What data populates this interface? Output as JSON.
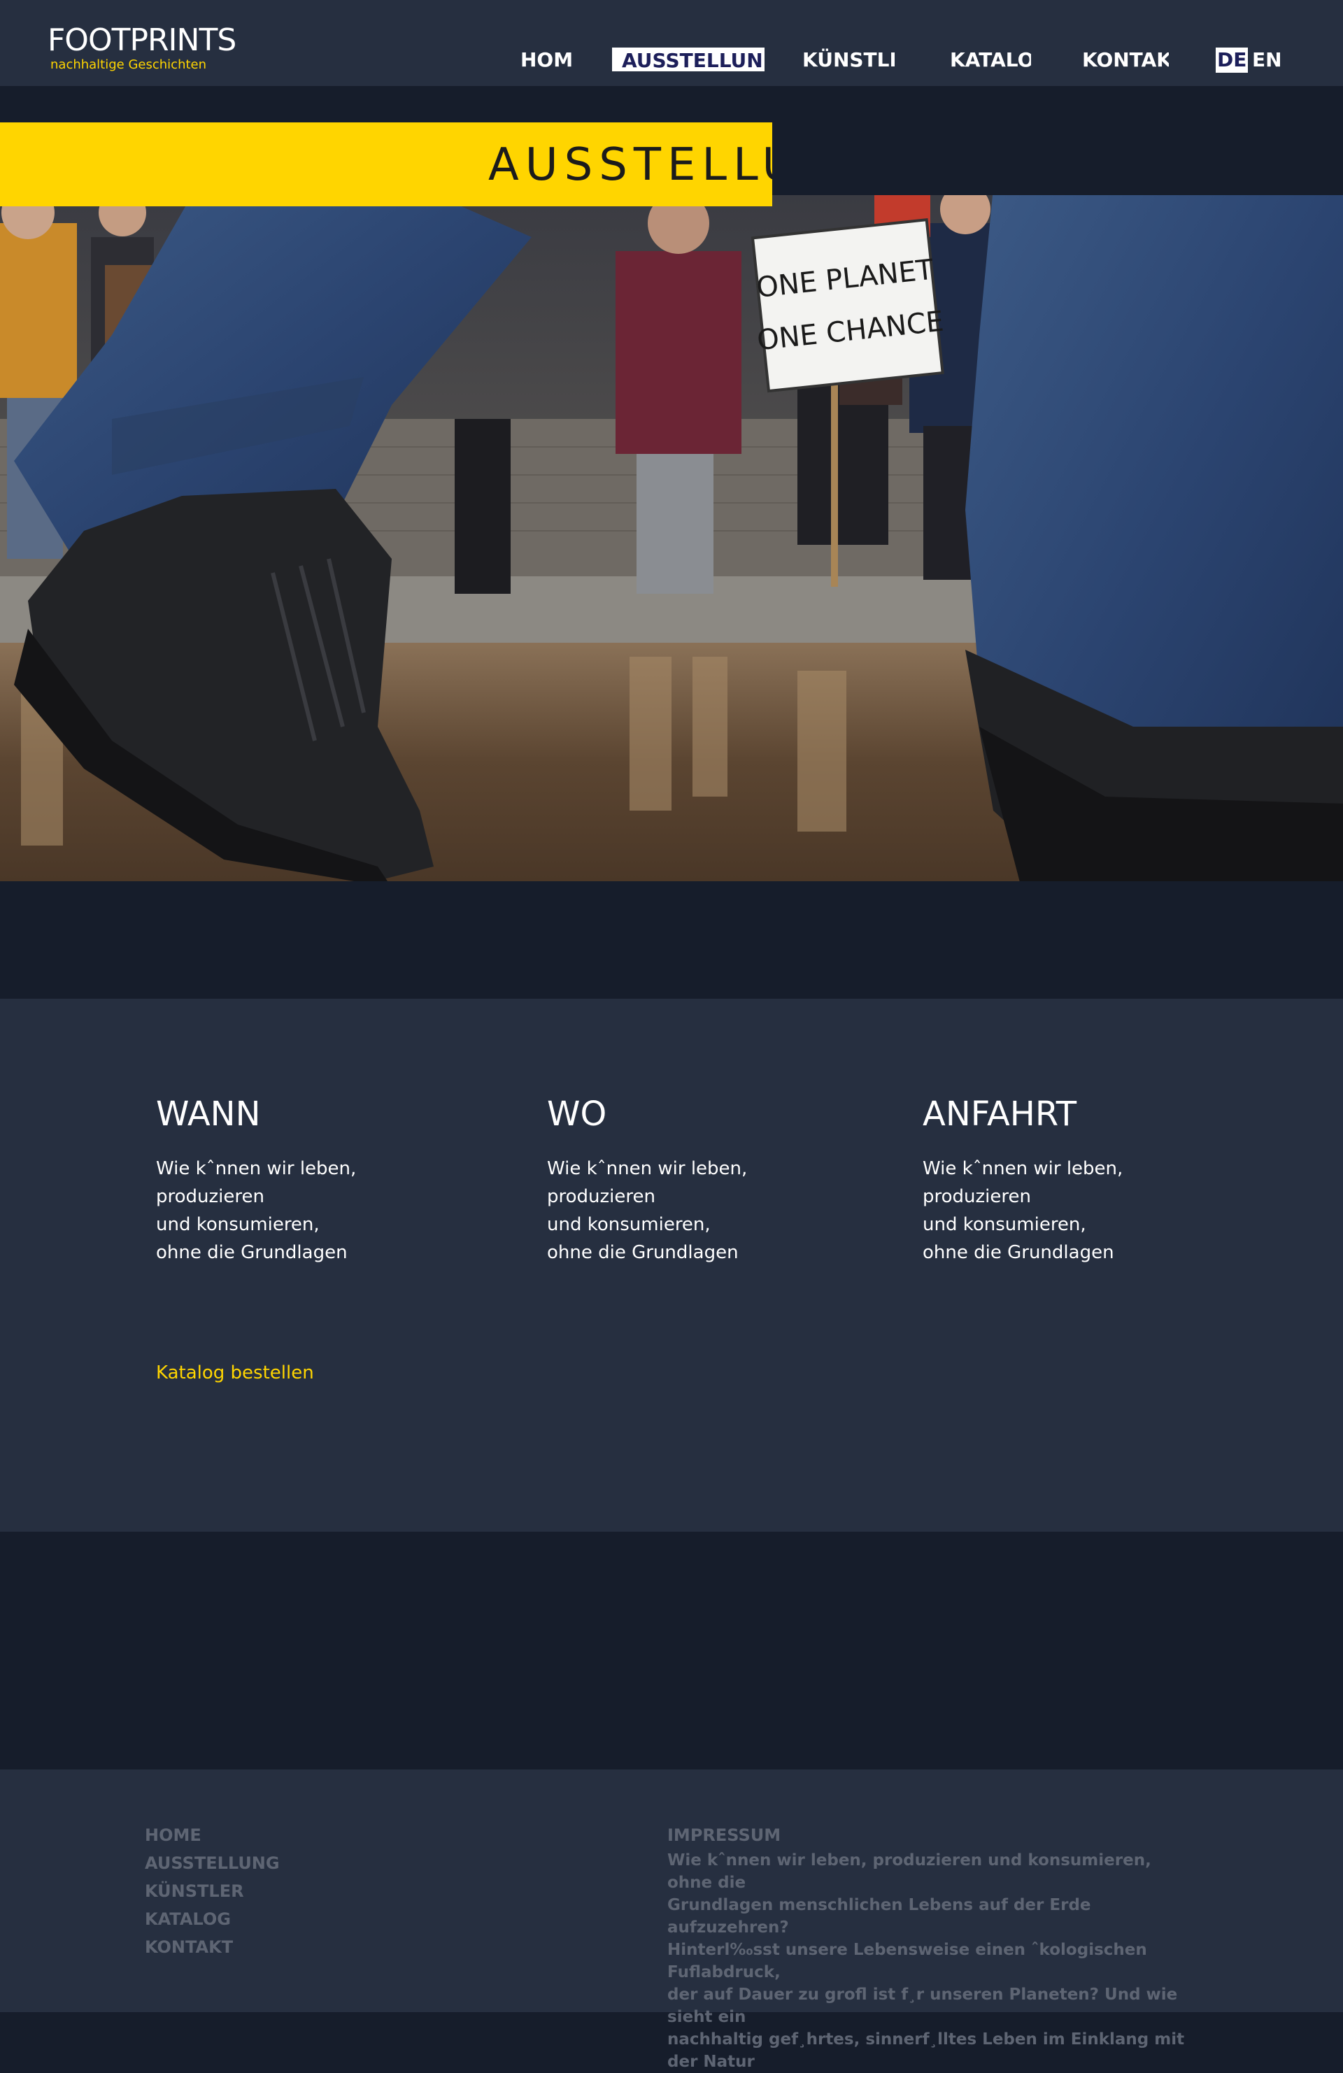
{
  "brand": {
    "name": "FOOTPRINTS",
    "tagline": "nachhaltige Geschichten"
  },
  "nav": {
    "items": [
      {
        "label": "HOM",
        "active": false
      },
      {
        "label": "AUSSTELLUN",
        "active": true
      },
      {
        "label": "KÜNSTLE",
        "active": false
      },
      {
        "label": "KATALO",
        "active": false
      },
      {
        "label": "KONTAK",
        "active": false
      }
    ],
    "languages": [
      {
        "label": "DE",
        "active": true
      },
      {
        "label": "EN",
        "active": false
      }
    ]
  },
  "hero": {
    "title": "AUSSTELLUN",
    "sign_line1": "ONE PLANET",
    "sign_line2": "ONE CHANCE"
  },
  "info": {
    "columns": [
      {
        "heading": "WANN",
        "lines": [
          "Wie kˆnnen wir leben,",
          "produzieren",
          "und konsumieren,",
          "ohne die Grundlagen"
        ]
      },
      {
        "heading": "WO",
        "lines": [
          "Wie kˆnnen wir leben,",
          "produzieren",
          "und konsumieren,",
          "ohne die Grundlagen"
        ]
      },
      {
        "heading": "ANFAHRT",
        "lines": [
          "Wie kˆnnen wir leben,",
          "produzieren",
          "und konsumieren,",
          "ohne die Grundlagen"
        ]
      }
    ],
    "catalog_link": "Katalog bestellen"
  },
  "footer": {
    "nav": [
      "HOME",
      "AUSSTELLUNG",
      "KÜNSTLER",
      "KATALOG",
      "KONTAKT"
    ],
    "impressum_title": "IMPRESSUM",
    "impressum_lines": [
      "Wie kˆnnen wir leben, produzieren und konsumieren, ohne die",
      "Grundlagen menschlichen Lebens auf der Erde aufzuzehren?",
      "Hinterl‰sst unsere Lebensweise einen ˆkologischen Fuflabdruck,",
      "der auf Dauer zu grofl ist f¸r unseren Planeten? Und wie sieht ein",
      "nachhaltig gef¸hrtes, sinnerf¸lltes Leben im Einklang mit der Natur"
    ]
  },
  "colors": {
    "header_bg": "#262f40",
    "page_bg": "#161d2b",
    "accent_yellow": "#ffd500",
    "footer_text": "#5e6573"
  }
}
